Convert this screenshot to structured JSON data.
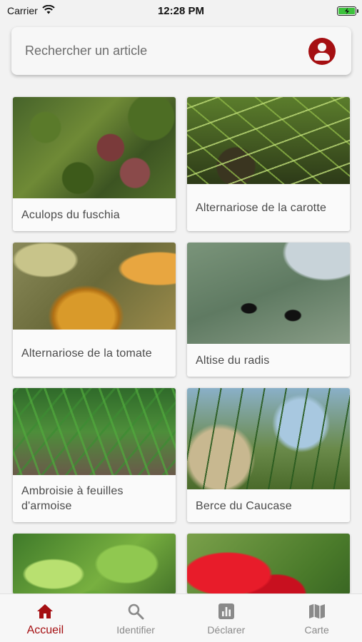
{
  "status_bar": {
    "carrier": "Carrier",
    "time": "12:28 PM"
  },
  "search": {
    "placeholder": "Rechercher un article",
    "profile_icon": "account-circle-icon"
  },
  "articles": [
    {
      "title": "Aculops du fuschia",
      "image": "aculops"
    },
    {
      "title": "Alternariose de la carotte",
      "image": "carotte"
    },
    {
      "title": "Alternariose de la tomate",
      "image": "tomate"
    },
    {
      "title": "Altise du radis",
      "image": "altise"
    },
    {
      "title": "Ambroisie à feuilles d'armoise",
      "image": "ambroisie"
    },
    {
      "title": "Berce du Caucase",
      "image": "berce"
    }
  ],
  "partial_articles": [
    {
      "image": "plant"
    },
    {
      "image": "red-flower"
    }
  ],
  "tab_bar": {
    "active": "Accueil",
    "tabs": [
      {
        "label": "Accueil",
        "icon": "home-icon"
      },
      {
        "label": "Identifier",
        "icon": "search-icon"
      },
      {
        "label": "Déclarer",
        "icon": "bar-chart-icon"
      },
      {
        "label": "Carte",
        "icon": "map-icon"
      }
    ]
  },
  "colors": {
    "accent": "#a50f12",
    "inactive": "#8a8a8a",
    "background": "#f2f2f2"
  }
}
